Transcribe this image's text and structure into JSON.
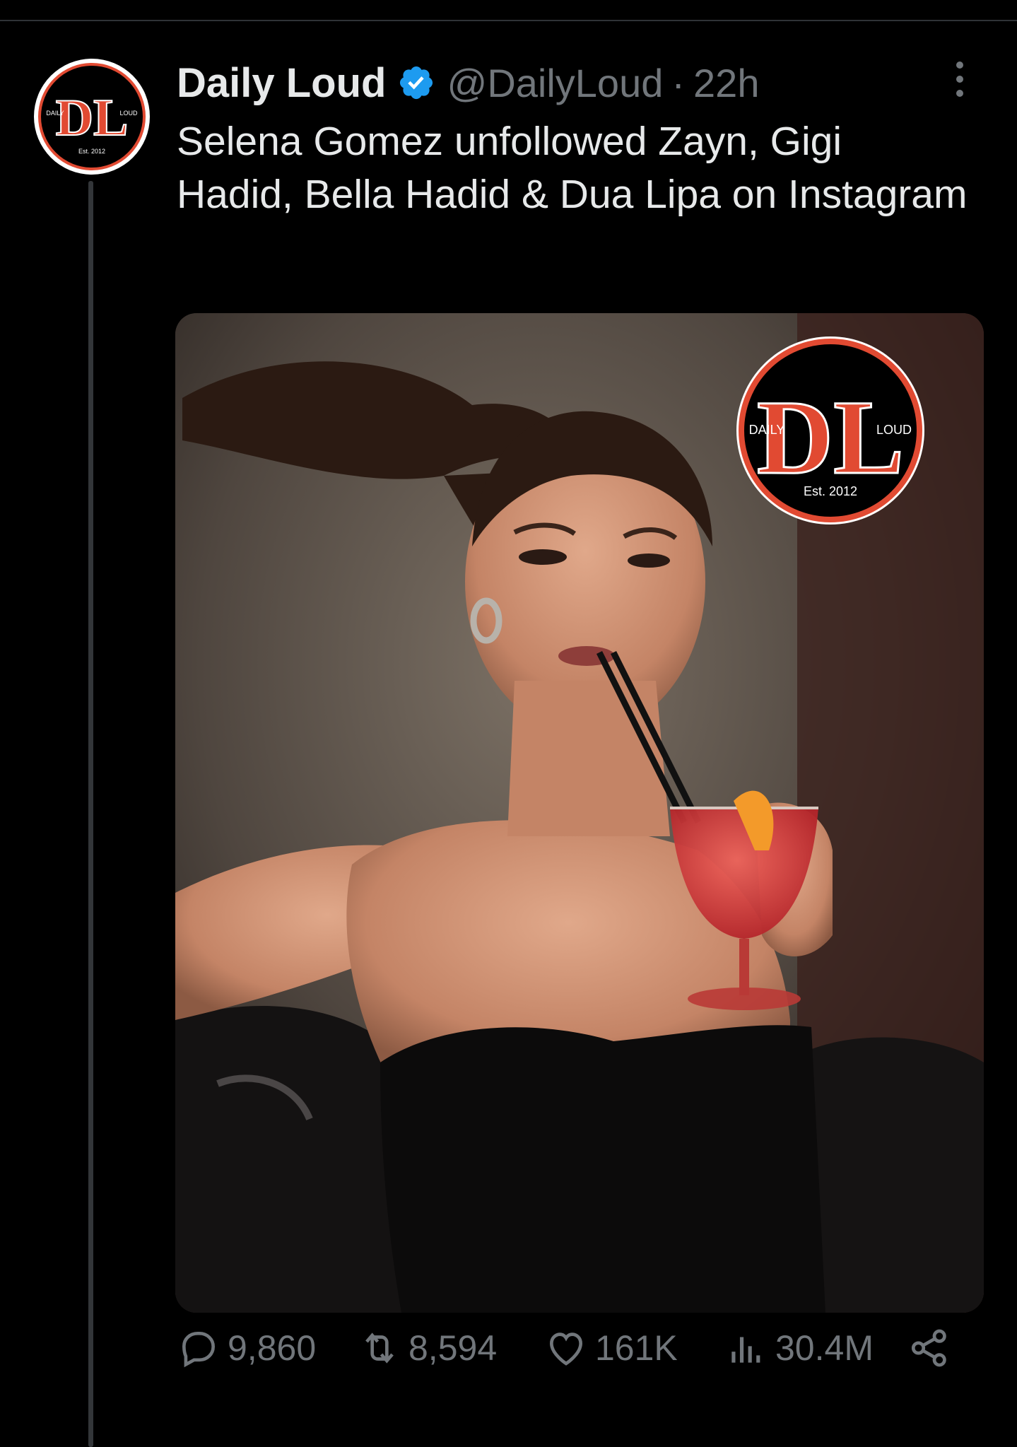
{
  "tweet": {
    "display_name": "Daily Loud",
    "handle": "@DailyLoud",
    "separator": "·",
    "time": "22h",
    "text": "Selena Gomez unfollowed Zayn, Gigi Hadid, Bella Hadid & Dua Lipa on Instagram",
    "avatar_logo": {
      "letters": "DL",
      "left_word": "DAILY",
      "right_word": "LOUD",
      "established": "Est. 2012"
    },
    "media": {
      "watermark_logo": {
        "letters": "DL",
        "left_word": "DAILY",
        "right_word": "LOUD",
        "established": "Est. 2012"
      }
    },
    "stats": {
      "replies": "9,860",
      "reposts": "8,594",
      "likes": "161K",
      "views": "30.4M"
    }
  },
  "colors": {
    "background": "#000000",
    "primary_text": "#e7e9ea",
    "secondary_text": "#71767b",
    "verified_badge": "#1d9bf0",
    "logo_red": "#e14a32"
  },
  "icons": {
    "verified": "verified-badge-icon",
    "more": "more-options-icon",
    "reply": "reply-icon",
    "repost": "repost-icon",
    "like": "like-icon",
    "views": "views-icon",
    "share": "share-icon"
  }
}
